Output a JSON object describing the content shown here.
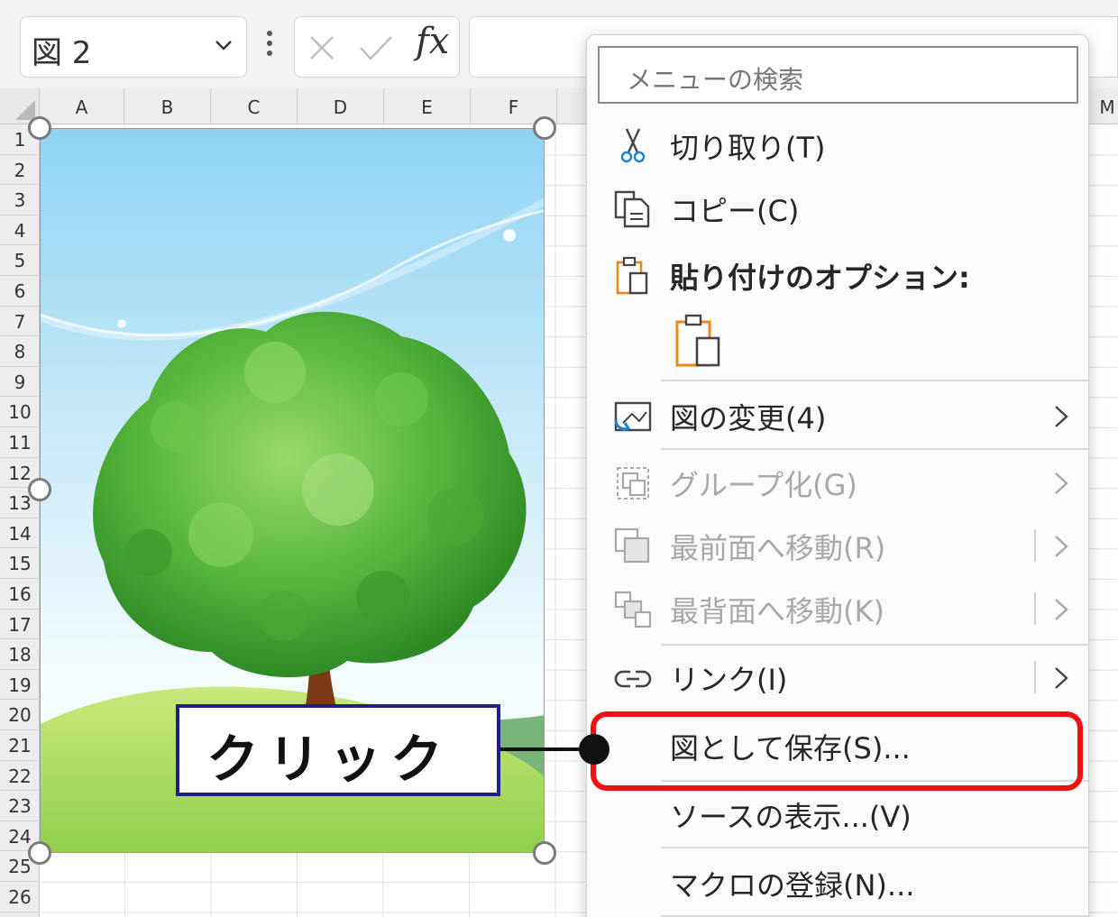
{
  "namebox": {
    "value": "図 2"
  },
  "formula_bar": {
    "fx_label": "fx"
  },
  "columns": [
    "A",
    "B",
    "C",
    "D",
    "E",
    "F",
    "M"
  ],
  "rows": [
    "1",
    "2",
    "3",
    "4",
    "5",
    "6",
    "7",
    "8",
    "9",
    "10",
    "11",
    "12",
    "13",
    "14",
    "15",
    "16",
    "17",
    "18",
    "19",
    "20",
    "21",
    "22",
    "23",
    "24",
    "25",
    "26"
  ],
  "context_menu": {
    "search_placeholder": "メニューの検索",
    "items": [
      {
        "label": "切り取り(T)",
        "icon": "scissors-icon",
        "enabled": true
      },
      {
        "label": "コピー(C)",
        "icon": "copy-icon",
        "enabled": true
      },
      {
        "label": "貼り付けのオプション:",
        "icon": "paste-icon",
        "enabled": true,
        "heading": true
      },
      {
        "label": "図の変更(4)",
        "icon": "change-picture-icon",
        "enabled": true,
        "submenu": true
      },
      {
        "label": "グループ化(G)",
        "icon": "group-icon",
        "enabled": false,
        "submenu": true
      },
      {
        "label": "最前面へ移動(R)",
        "icon": "bring-to-front-icon",
        "enabled": false,
        "submenu": true
      },
      {
        "label": "最背面へ移動(K)",
        "icon": "send-to-back-icon",
        "enabled": false,
        "submenu": true
      },
      {
        "label": "リンク(I)",
        "icon": "link-icon",
        "enabled": true,
        "submenu": true
      },
      {
        "label": "図として保存(S)...",
        "icon": "",
        "enabled": true,
        "highlighted": true
      },
      {
        "label": "ソースの表示...(V)",
        "icon": "",
        "enabled": true
      },
      {
        "label": "マクロの登録(N)...",
        "icon": "",
        "enabled": true
      }
    ]
  },
  "callout": {
    "text": "クリック"
  },
  "colors": {
    "highlight": "#ee1111",
    "callout_border": "#1f1f8a",
    "paste_accent": "#e8891c",
    "sky": "#a9dcf5",
    "leaves": "#4caf2e"
  }
}
